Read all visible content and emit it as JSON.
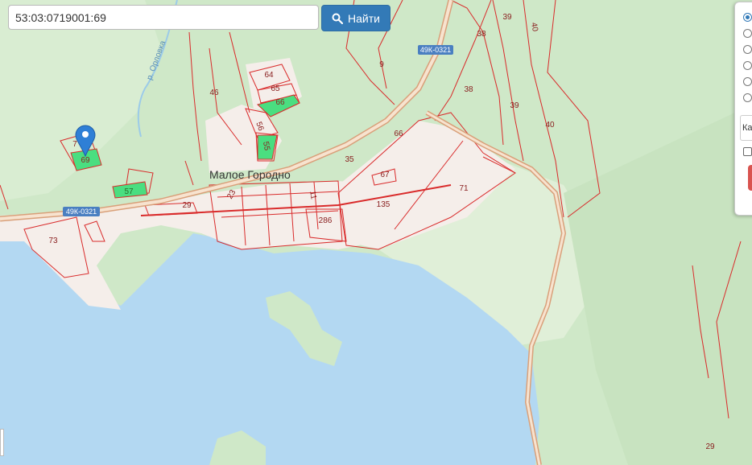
{
  "search": {
    "value": "53:03:0719001:69",
    "button_label": "Найти"
  },
  "map": {
    "village_label": "Малое Городно",
    "river_label": "р. Орловка",
    "road_labels": [
      "49К-0321",
      "49К-0321"
    ],
    "parcel_labels": [
      "39",
      "40",
      "38",
      "38",
      "39",
      "40",
      "9",
      "46",
      "64",
      "65",
      "66",
      "56",
      "55",
      "66",
      "35",
      "67",
      "71",
      "135",
      "286",
      "11",
      "23",
      "29",
      "57",
      "69",
      "7",
      "73",
      "29"
    ],
    "colors": {
      "forest": "#cfe8c8",
      "clearing": "#e2f0d9",
      "water": "#b3d8f2",
      "settlement": "#f5eeea",
      "boundary": "#d92b2b",
      "highlight": "#4ade80",
      "road": "#e8c6a8",
      "marker": "#2f7fd6"
    }
  },
  "panel": {
    "select_value": "Кадастровые участки",
    "selected_radio": 0,
    "radio_count": 6
  },
  "icons": {
    "search_button": "search-icon",
    "marker": "map-marker-icon"
  }
}
